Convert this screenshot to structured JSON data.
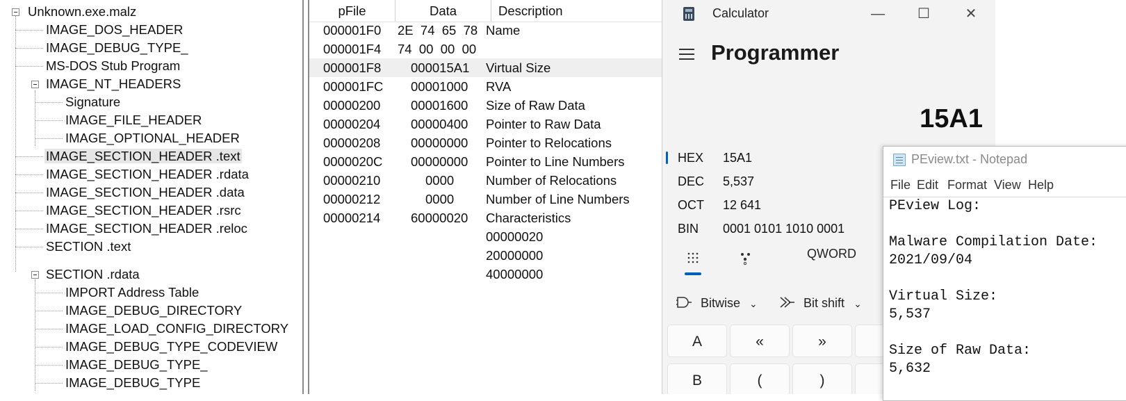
{
  "tree": {
    "root": "Unknown.exe.malz",
    "items": [
      "IMAGE_DOS_HEADER",
      "IMAGE_DEBUG_TYPE_",
      "MS-DOS Stub Program",
      "IMAGE_NT_HEADERS",
      "Signature",
      "IMAGE_FILE_HEADER",
      "IMAGE_OPTIONAL_HEADER",
      "IMAGE_SECTION_HEADER .text",
      "IMAGE_SECTION_HEADER .rdata",
      "IMAGE_SECTION_HEADER .data",
      "IMAGE_SECTION_HEADER .rsrc",
      "IMAGE_SECTION_HEADER .reloc",
      "SECTION .text",
      "SECTION .rdata",
      "IMPORT Address Table",
      "IMAGE_DEBUG_DIRECTORY",
      "IMAGE_LOAD_CONFIG_DIRECTORY",
      "IMAGE_DEBUG_TYPE_CODEVIEW",
      "IMAGE_DEBUG_TYPE_",
      "IMAGE_DEBUG_TYPE"
    ]
  },
  "grid": {
    "headers": [
      "pFile",
      "Data",
      "Description"
    ],
    "rows": [
      {
        "pfile": "000001F0",
        "data": "2E  74  65  78",
        "desc": "Name"
      },
      {
        "pfile": "000001F4",
        "data": "74  00  00  00",
        "desc": ""
      },
      {
        "pfile": "000001F8",
        "data": "000015A1",
        "desc": "Virtual Size"
      },
      {
        "pfile": "000001FC",
        "data": "00001000",
        "desc": "RVA"
      },
      {
        "pfile": "00000200",
        "data": "00001600",
        "desc": "Size of Raw Data"
      },
      {
        "pfile": "00000204",
        "data": "00000400",
        "desc": "Pointer to Raw Data"
      },
      {
        "pfile": "00000208",
        "data": "00000000",
        "desc": "Pointer to Relocations"
      },
      {
        "pfile": "0000020C",
        "data": "00000000",
        "desc": "Pointer to Line Numbers"
      },
      {
        "pfile": "00000210",
        "data": "0000",
        "desc": "Number of Relocations"
      },
      {
        "pfile": "00000212",
        "data": "0000",
        "desc": "Number of Line Numbers"
      },
      {
        "pfile": "00000214",
        "data": "60000020",
        "desc": "Characteristics"
      },
      {
        "pfile": "",
        "data": "",
        "desc": "00000020"
      },
      {
        "pfile": "",
        "data": "",
        "desc": "20000000"
      },
      {
        "pfile": "",
        "data": "",
        "desc": "40000000"
      }
    ]
  },
  "calculator": {
    "title": "Calculator",
    "mode": "Programmer",
    "display": "15A1",
    "radix": [
      {
        "name": "HEX",
        "value": "15A1"
      },
      {
        "name": "DEC",
        "value": "5,537"
      },
      {
        "name": "OCT",
        "value": "12 641"
      },
      {
        "name": "BIN",
        "value": "0001 0101 1010 0001"
      }
    ],
    "word_size": "QWORD",
    "bitwise_label": "Bitwise",
    "bitshift_label": "Bit shift",
    "keys_row1": [
      "A",
      "«",
      "»",
      ""
    ],
    "keys_row2": [
      "B",
      "(",
      ")",
      ""
    ],
    "accent": "#005fb8"
  },
  "notepad": {
    "title": "PEview.txt - Notepad",
    "menu": [
      "File",
      "Edit",
      "Format",
      "View",
      "Help"
    ],
    "lines": [
      "PEview Log:",
      "",
      "Malware Compilation Date:",
      "2021/09/04",
      "",
      "Virtual Size:",
      "5,537",
      "",
      "Size of Raw Data:",
      "5,632"
    ]
  }
}
